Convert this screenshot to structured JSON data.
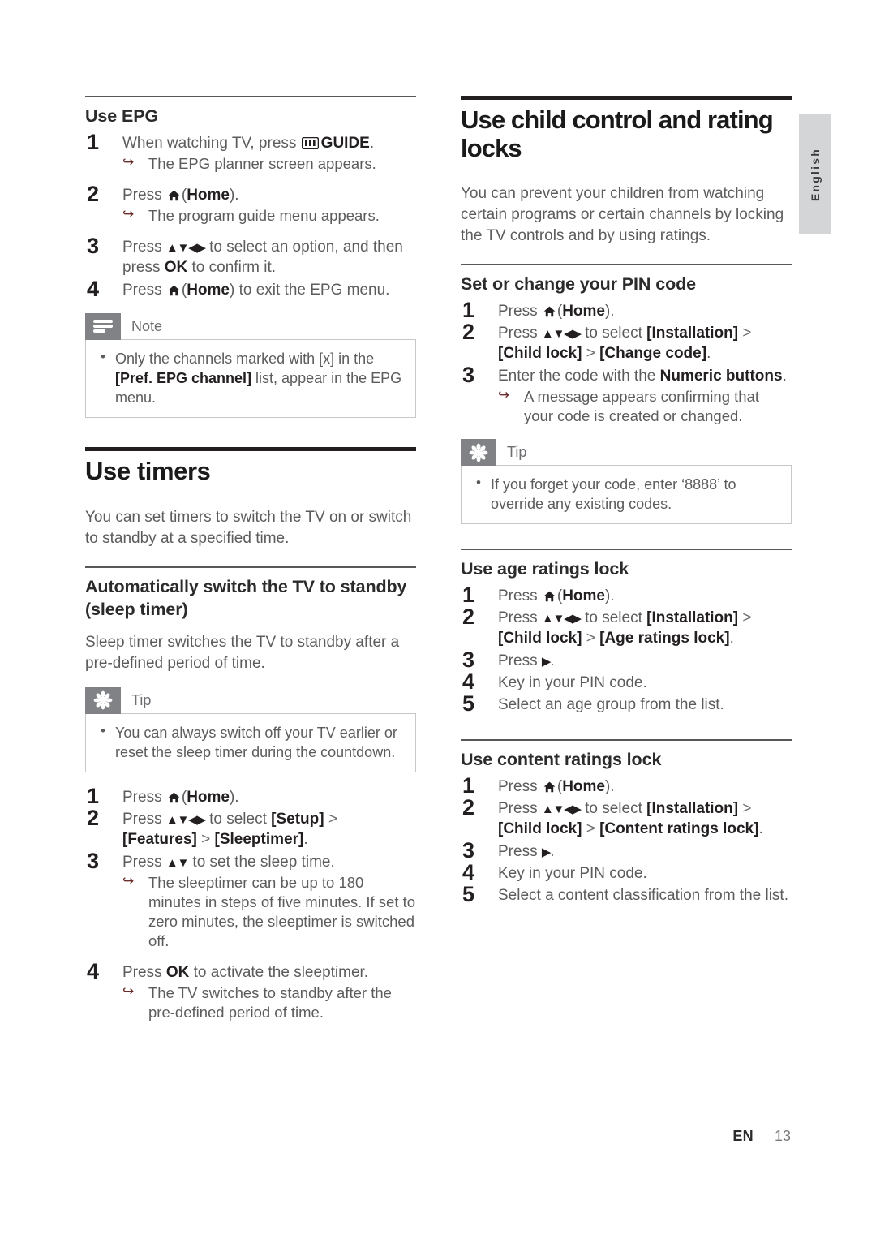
{
  "page": {
    "language_tab": "English",
    "footer_lang": "EN",
    "footer_page": "13"
  },
  "left_column": {
    "epg": {
      "heading": "Use EPG",
      "steps": [
        {
          "text_before": "When watching TV, press ",
          "icon": "guide-icon",
          "bold": "GUIDE",
          "text_after": ".",
          "result": "The EPG planner screen appears."
        },
        {
          "text_before": "Press ",
          "icon": "home-icon",
          "paren_open": "(",
          "bold": "Home",
          "paren_close": ").",
          "result": "The program guide menu appears."
        },
        {
          "text_before": "Press ",
          "nav": "▲▼◀▶",
          "text_mid": " to select an option, and then press ",
          "bold": "OK",
          "text_after": " to confirm it."
        },
        {
          "text_before": "Press ",
          "icon": "home-icon",
          "paren_open": "(",
          "bold": "Home",
          "paren_close": ") to exit the EPG menu."
        }
      ],
      "note": {
        "title": "Note",
        "icon": "note-icon",
        "item_part1": "Only the channels marked with [x] in the ",
        "item_bold": "[Pref. EPG channel]",
        "item_part2": " list, appear in the EPG menu."
      }
    },
    "timers": {
      "heading": "Use timers",
      "intro": "You can set timers to switch the TV on or switch to standby at a specified time.",
      "sleep": {
        "heading": "Automatically switch the TV to standby (sleep timer)",
        "intro": "Sleep timer switches the TV to standby after a pre-defined period of time.",
        "tip": {
          "title": "Tip",
          "icon": "tip-icon",
          "item": "You can always switch off your TV earlier or reset the sleep timer during the countdown."
        },
        "steps": [
          {
            "text_before": "Press ",
            "icon": "home-icon",
            "paren_open": "(",
            "bold": "Home",
            "paren_close": ")."
          },
          {
            "text_before": "Press ",
            "nav": "▲▼◀▶",
            "text_mid": " to select ",
            "bold": "[Setup]",
            "gt1": " > ",
            "bold2": "[Features]",
            "gt2": " > ",
            "bold3": "[Sleeptimer]",
            "text_after": "."
          },
          {
            "text_before": "Press ",
            "nav": "▲▼",
            "text_mid": " to set the sleep time.",
            "result": "The sleeptimer can be up to 180 minutes in steps of five minutes. If set to zero minutes, the sleeptimer is switched off."
          },
          {
            "text_before": "Press ",
            "bold": "OK",
            "text_after": " to activate the sleeptimer.",
            "result": "The TV switches to standby after the pre-defined period of time."
          }
        ]
      }
    }
  },
  "right_column": {
    "child_control": {
      "heading": "Use child control and rating locks",
      "intro": "You can prevent your children from watching certain programs or certain channels by locking the TV controls and by using ratings.",
      "pin": {
        "heading": "Set or change your PIN code",
        "steps": [
          {
            "text_before": "Press ",
            "icon": "home-icon",
            "paren_open": "(",
            "bold": "Home",
            "paren_close": ")."
          },
          {
            "text_before": "Press ",
            "nav": "▲▼◀▶",
            "text_mid": " to select ",
            "bold": "[Installation]",
            "gt1": " > ",
            "bold2": "[Child lock]",
            "gt2": " > ",
            "bold3": "[Change code]",
            "text_after": "."
          },
          {
            "text_before": "Enter the code with the ",
            "bold": "Numeric buttons",
            "text_after": ".",
            "result": "A message appears confirming that your code is created or changed."
          }
        ],
        "tip": {
          "title": "Tip",
          "icon": "tip-icon",
          "item": "If you forget your code, enter ‘8888’ to override any existing codes."
        }
      },
      "age_lock": {
        "heading": "Use age ratings lock",
        "steps": [
          {
            "text_before": "Press ",
            "icon": "home-icon",
            "paren_open": "(",
            "bold": "Home",
            "paren_close": ")."
          },
          {
            "text_before": "Press ",
            "nav": "▲▼◀▶",
            "text_mid": " to select ",
            "bold": "[Installation]",
            "gt1": " > ",
            "bold2": "[Child lock]",
            "gt2": " > ",
            "bold3": "[Age ratings lock]",
            "text_after": "."
          },
          {
            "text_before": "Press ",
            "nav": "▶",
            "text_after": "."
          },
          {
            "text_before": "Key in your PIN code."
          },
          {
            "text_before": "Select an age group from the list."
          }
        ]
      },
      "content_lock": {
        "heading": "Use content ratings lock",
        "steps": [
          {
            "text_before": "Press ",
            "icon": "home-icon",
            "paren_open": "(",
            "bold": "Home",
            "paren_close": ")."
          },
          {
            "text_before": "Press ",
            "nav": "▲▼◀▶",
            "text_mid": " to select ",
            "bold": "[Installation]",
            "gt1": " > ",
            "bold2": "[Child lock]",
            "gt2": " > ",
            "bold3": "[Content ratings lock]",
            "text_after": "."
          },
          {
            "text_before": "Press ",
            "nav": "▶",
            "text_after": "."
          },
          {
            "text_before": "Key in your PIN code."
          },
          {
            "text_before": "Select a content classification from the list."
          }
        ]
      }
    }
  },
  "colors": {
    "badge_gray": "#808285",
    "tab_gray": "#d4d5d7",
    "rule_black": "#231f20",
    "body_text": "#5c5c5e"
  }
}
